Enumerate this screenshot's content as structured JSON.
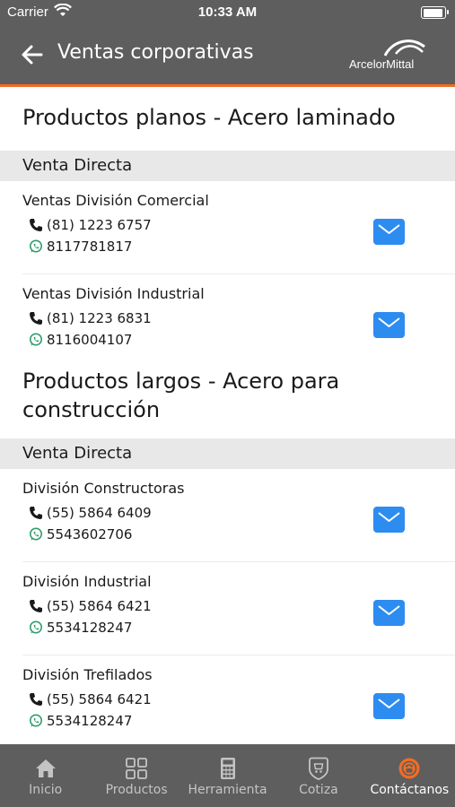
{
  "status_bar": {
    "carrier": "Carrier",
    "time": "10:33 AM"
  },
  "nav": {
    "title": "Ventas corporativas",
    "logo_text": "ArcelorMittal"
  },
  "sections": [
    {
      "title": "Productos planos - Acero laminado",
      "subheader": "Venta Directa",
      "contacts": [
        {
          "name": "Ventas División Comercial",
          "phone": "(81) 1223 6757",
          "whatsapp": "8117781817"
        },
        {
          "name": "Ventas División Industrial",
          "phone": "(81) 1223 6831",
          "whatsapp": "8116004107"
        }
      ]
    },
    {
      "title": "Productos largos - Acero para construcción",
      "subheader": "Venta Directa",
      "contacts": [
        {
          "name": "División Constructoras",
          "phone": "(55) 5864 6409",
          "whatsapp": "5543602706"
        },
        {
          "name": "División Industrial",
          "phone": "(55) 5864 6421",
          "whatsapp": "5534128247"
        },
        {
          "name": "División Trefilados",
          "phone": "(55) 5864 6421",
          "whatsapp": "5534128247"
        }
      ]
    }
  ],
  "tabs": [
    {
      "label": "Inicio",
      "icon": "home-icon"
    },
    {
      "label": "Productos",
      "icon": "grid-icon"
    },
    {
      "label": "Herramienta",
      "icon": "calculator-icon"
    },
    {
      "label": "Cotiza",
      "icon": "quote-badge-icon"
    },
    {
      "label": "Contáctanos",
      "icon": "contact-icon",
      "active": true
    }
  ],
  "colors": {
    "header_bg": "#5e5e5e",
    "accent": "#f26c23",
    "mail_button": "#2d8cf0",
    "whatsapp": "#2e9e6a",
    "active_tab_icon": "#f26c23"
  }
}
